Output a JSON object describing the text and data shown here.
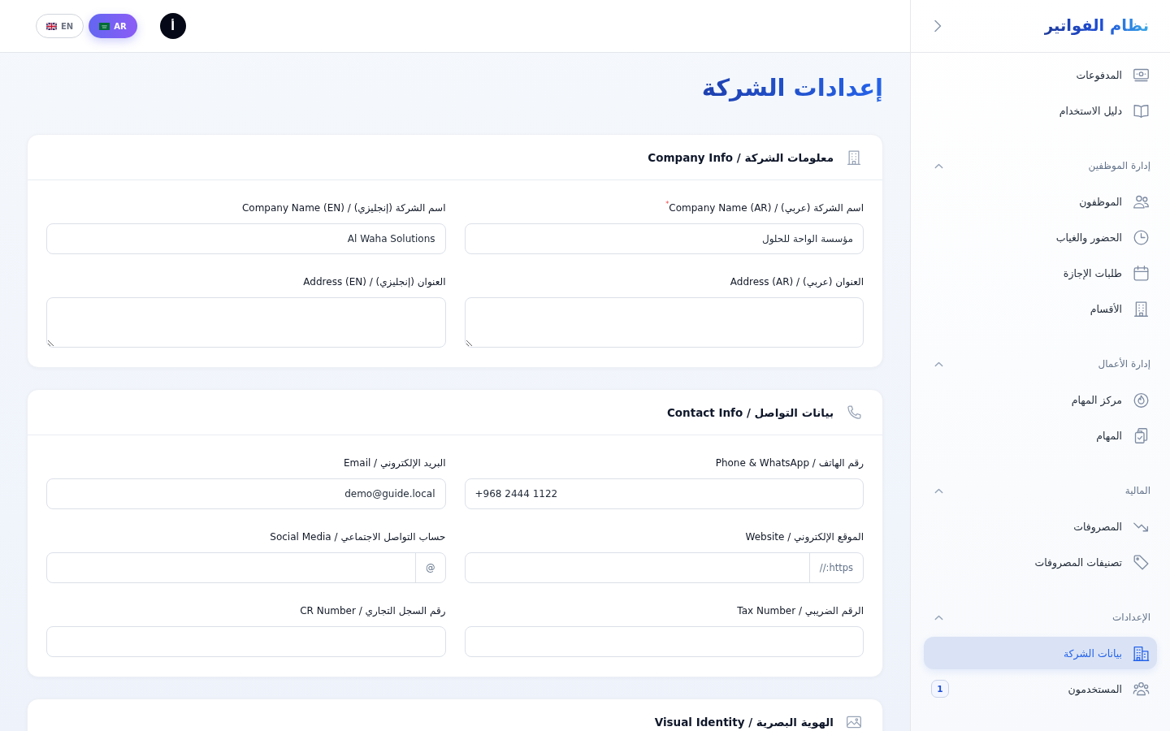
{
  "header": {
    "avatar": "أ",
    "languages": [
      {
        "label": "AR",
        "selected": true
      },
      {
        "label": "EN",
        "selected": false
      }
    ]
  },
  "sidebar": {
    "logo": "نظام الفواتير",
    "items": [
      {
        "label": "المدفوعات",
        "selected": false
      },
      {
        "label": "دليل الاستخدام",
        "selected": false
      }
    ],
    "sections": [
      {
        "title": "إدارة الموظفين",
        "expanded": true,
        "items": [
          {
            "label": "الموظفون",
            "selected": false
          },
          {
            "label": "الحضور والغياب",
            "selected": false
          },
          {
            "label": "طلبات الإجازة",
            "selected": false
          },
          {
            "label": "الأقسام",
            "selected": false
          }
        ]
      },
      {
        "title": "إدارة الأعمال",
        "expanded": true,
        "items": [
          {
            "label": "مركز المهام",
            "selected": false
          },
          {
            "label": "المهام",
            "selected": false
          }
        ]
      },
      {
        "title": "المالية",
        "expanded": true,
        "items": [
          {
            "label": "المصروفات",
            "selected": false
          },
          {
            "label": "تصنيفات المصروفات",
            "selected": false
          }
        ]
      },
      {
        "title": "الإعدادات",
        "expanded": true,
        "items": [
          {
            "label": "بيانات الشركة",
            "selected": true
          },
          {
            "label": "المستخدمون",
            "selected": false,
            "badge": "1"
          }
        ]
      }
    ]
  },
  "page": {
    "title": "إعدادات الشركة"
  },
  "cards": [
    {
      "title": "معلومات الشركة / Company Info",
      "fields": [
        {
          "kind": "text",
          "label": "اسم الشركة (عربي) / Company Name (AR)$^{*}$",
          "value": "مؤسسة الواحة للحلول"
        },
        {
          "kind": "text",
          "label": "اسم الشركة (إنجليزي) / Company Name (EN)",
          "value": "Al Waha Solutions"
        },
        {
          "kind": "textarea",
          "label": "العنوان (عربي) / Address (AR)"
        },
        {
          "kind": "textarea",
          "label": "العنوان (إنجليزي) / Address (EN)"
        }
      ]
    },
    {
      "title": "بيانات التواصل / Contact Info",
      "fields": [
        {
          "kind": "phone",
          "label": "رقم الهاتف / Phone & WhatsApp",
          "value": "+968 2444 1122"
        },
        {
          "kind": "text",
          "label": "البريد الإلكتروني / Email",
          "value": "demo@guide.local"
        },
        {
          "kind": "prefixed",
          "label": "الموقع الإلكتروني / Website",
          "prefix": "https://"
        },
        {
          "kind": "prefixed",
          "label": "حساب التواصل الاجتماعي / Social Media",
          "prefix": "@"
        },
        {
          "kind": "text",
          "label": "الرقم الضريبي / Tax Number"
        },
        {
          "kind": "text",
          "label": "رقم السجل التجاري / CR Number"
        }
      ]
    },
    {
      "title": "الهوية البصرية / Visual Identity"
    }
  ]
}
